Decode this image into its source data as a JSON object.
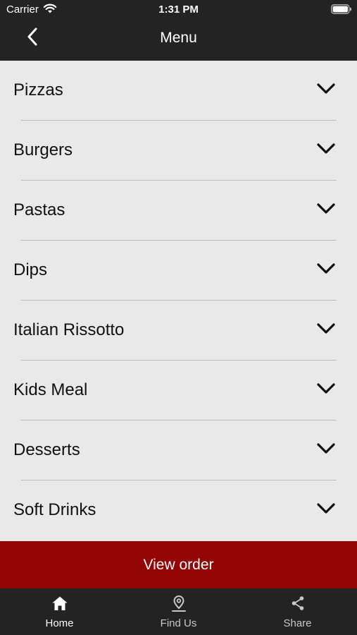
{
  "status_bar": {
    "carrier": "Carrier",
    "time": "1:31 PM",
    "wifi_icon": "wifi-icon",
    "battery_icon": "battery-icon"
  },
  "nav": {
    "back_icon": "chevron-left-icon",
    "title": "Menu"
  },
  "menu": {
    "items": [
      {
        "label": "Pizzas"
      },
      {
        "label": "Burgers"
      },
      {
        "label": "Pastas"
      },
      {
        "label": "Dips"
      },
      {
        "label": "Italian Rissotto"
      },
      {
        "label": "Kids Meal"
      },
      {
        "label": "Desserts"
      },
      {
        "label": "Soft Drinks"
      }
    ],
    "expand_icon": "chevron-down-icon"
  },
  "order_button": {
    "label": "View order"
  },
  "tabs": [
    {
      "label": "Home",
      "icon": "home-icon",
      "active": true
    },
    {
      "label": "Find Us",
      "icon": "location-pin-icon",
      "active": false
    },
    {
      "label": "Share",
      "icon": "share-icon",
      "active": false
    }
  ],
  "colors": {
    "header_bg": "#232323",
    "list_bg": "#e9e9e9",
    "accent": "#940505",
    "tab_active": "#ffffff",
    "tab_inactive": "#c8c8c8"
  }
}
